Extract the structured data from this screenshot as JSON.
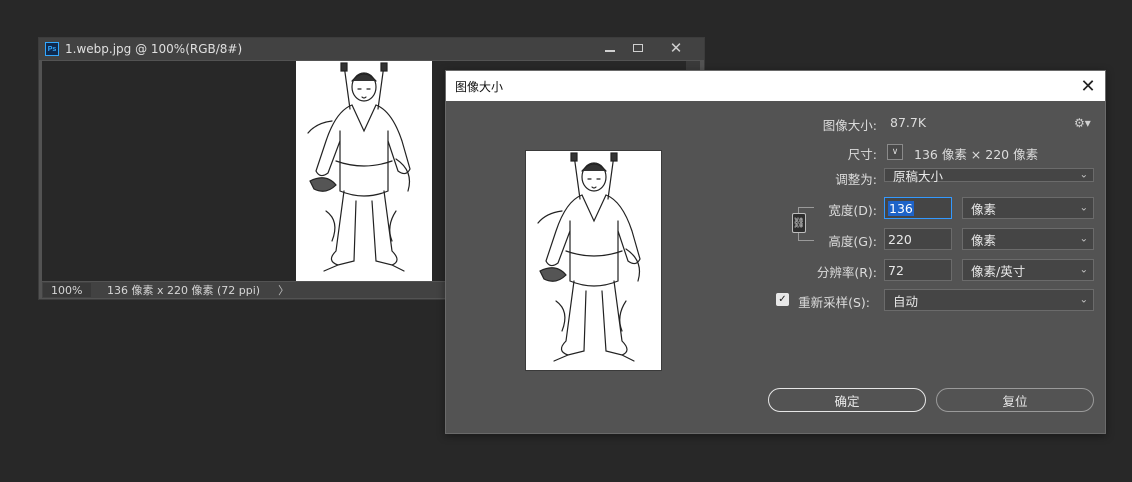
{
  "document": {
    "title": "1.webp.jpg @ 100%(RGB/8#)",
    "app_icon_text": "Ps",
    "zoom": "100%",
    "status": "136 像素 x 220 像素 (72 ppi)",
    "status_arrow": "〉"
  },
  "dialog": {
    "title": "图像大小",
    "image_size_label": "图像大小:",
    "image_size_value": "87.7K",
    "dimensions_label": "尺寸:",
    "dimensions_value": "136 像素  ×  220 像素",
    "fit_to_label": "调整为:",
    "fit_to_value": "原稿大小",
    "width_label": "宽度(D):",
    "width_value": "136",
    "width_unit": "像素",
    "height_label": "高度(G):",
    "height_value": "220",
    "height_unit": "像素",
    "resolution_label": "分辨率(R):",
    "resolution_value": "72",
    "resolution_unit": "像素/英寸",
    "resample_label": "重新采样(S):",
    "resample_checked": true,
    "resample_value": "自动",
    "ok_label": "确定",
    "reset_label": "复位"
  },
  "icons": {
    "gear": "gear-icon",
    "link": "link-icon",
    "close": "close-icon",
    "chevron": "chevron-down-icon"
  },
  "colors": {
    "background": "#282828",
    "panel": "#535353",
    "accent": "#1e63c8",
    "focus_border": "#3399ff"
  }
}
